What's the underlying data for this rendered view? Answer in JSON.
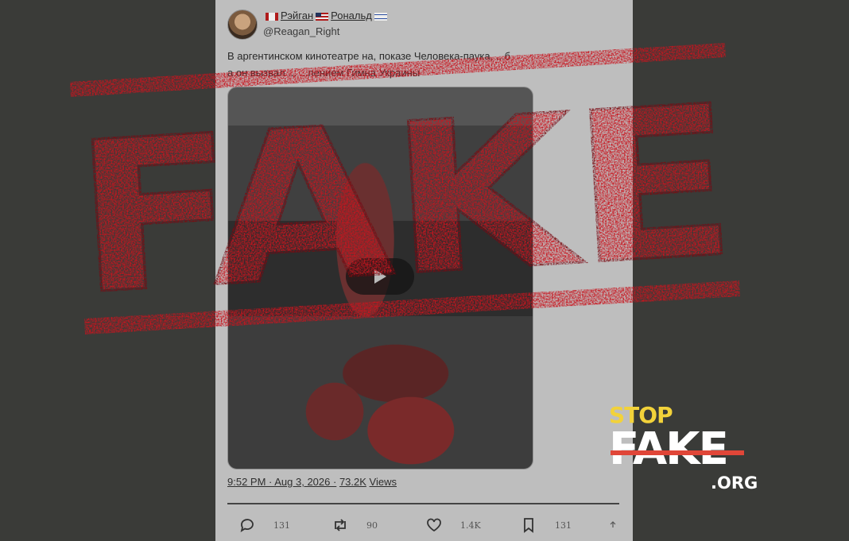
{
  "tweet": {
    "display_name": "Рэйган",
    "display_name_2": "Рональд",
    "handle": "@Reagan_Right",
    "text_line1": "В аргентинском кинотеатре на, показе Человека-паука, ...б",
    "text_line2": "а он вызвал ...  ...пением Гимна Украины",
    "timestamp": "9:52 PM · Aug 3, 2026 ·",
    "views_count": "73.2K",
    "views_label": "Views",
    "replies": "131",
    "reposts": "90",
    "likes": "1.4K",
    "bookmarks": "131"
  },
  "stamp": {
    "text": "FAKE",
    "color": "#c8141e"
  },
  "logo": {
    "top": "STOP",
    "main": "FAKE",
    "suffix": ".ORG",
    "top_color": "#f2d23a",
    "bar_color": "#e04638"
  },
  "icons": [
    "reply-icon",
    "repost-icon",
    "like-icon",
    "bookmark-icon",
    "share-icon",
    "play-icon"
  ]
}
